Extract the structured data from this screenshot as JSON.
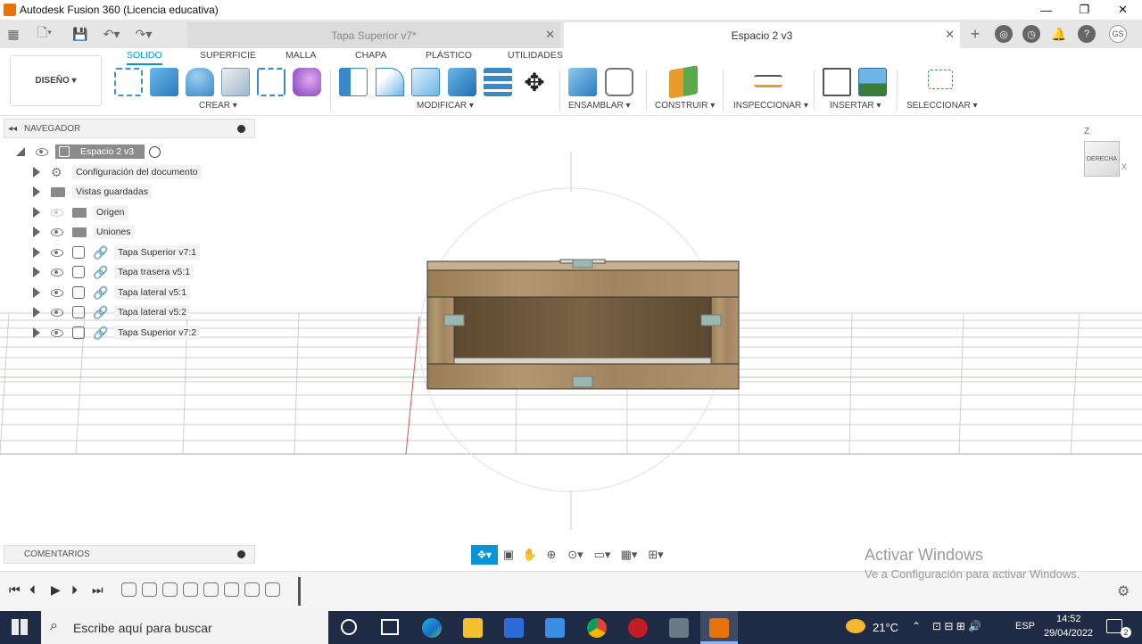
{
  "window": {
    "title": "Autodesk Fusion 360 (Licencia educativa)",
    "minimize": "—",
    "restore": "❐",
    "close": "✕"
  },
  "tabs": [
    {
      "label": "Tapa Superior v7*",
      "active": false
    },
    {
      "label": "Espacio 2 v3",
      "active": true
    }
  ],
  "toolbar": {
    "workspace": "DISEÑO ▾",
    "tabs": [
      "SOLIDO",
      "SUPERFICIE",
      "MALLA",
      "CHAPA",
      "PLÁSTICO",
      "UTILIDADES"
    ],
    "groups": [
      "CREAR ▾",
      "MODIFICAR ▾",
      "ENSAMBLAR ▾",
      "CONSTRUIR ▾",
      "INSPECCIONAR ▾",
      "INSERTAR ▾",
      "SELECCIONAR ▾"
    ]
  },
  "browser": {
    "header": "NAVEGADOR",
    "root": "Espacio 2 v3",
    "items": [
      {
        "label": "Configuración del documento",
        "kind": "settings"
      },
      {
        "label": "Vistas guardadas",
        "kind": "folder"
      },
      {
        "label": "Origen",
        "kind": "folder"
      },
      {
        "label": "Uniones",
        "kind": "folder"
      },
      {
        "label": "Tapa Superior v7:1",
        "kind": "component"
      },
      {
        "label": "Tapa trasera v5:1",
        "kind": "component"
      },
      {
        "label": "Tapa lateral v5:1",
        "kind": "component"
      },
      {
        "label": "Tapa lateral v5:2",
        "kind": "component"
      },
      {
        "label": "Tapa Superior v7:2",
        "kind": "component"
      }
    ]
  },
  "viewcube": {
    "face": "DERECHA",
    "z": "Z",
    "x": "X"
  },
  "comments": {
    "label": "COMENTARIOS"
  },
  "watermark": {
    "line1": "Activar Windows",
    "line2": "Ve a Configuración para activar Windows."
  },
  "taskbar": {
    "search_placeholder": "Escribe aquí para buscar",
    "weather": "21°C",
    "lang": "ESP",
    "time": "14:52",
    "date": "29/04/2022",
    "notifications": "2"
  },
  "colors": {
    "accent": "#0696d7",
    "wood": "#a88c64",
    "wood_dark": "#6e5638",
    "brand": "#e8720c"
  }
}
